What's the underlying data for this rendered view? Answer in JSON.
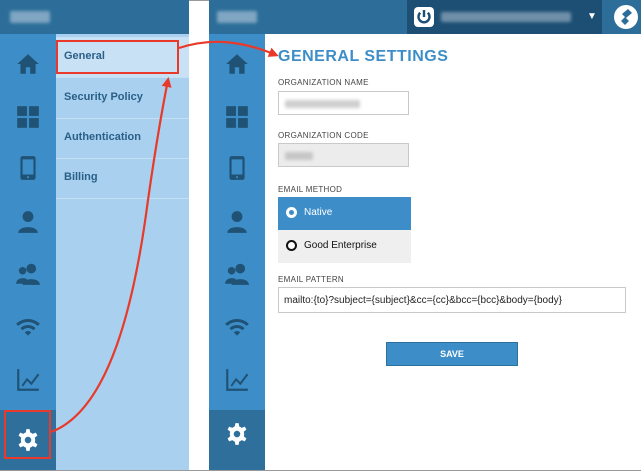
{
  "left_panel": {
    "rail_icons": [
      "home-icon",
      "dashboard-icon",
      "mobile-device-icon",
      "user-icon",
      "users-icon",
      "wifi-icon",
      "analytics-icon",
      "gear-icon"
    ],
    "submenu": [
      {
        "label": "General",
        "active": true
      },
      {
        "label": "Security Policy",
        "active": false
      },
      {
        "label": "Authentication",
        "active": false
      },
      {
        "label": "Billing",
        "active": false
      }
    ]
  },
  "header": {
    "user_caret": "▼",
    "accent_color": "#3d8ec8",
    "topbar_color": "#2c6e99"
  },
  "settings": {
    "title": "GENERAL SETTINGS",
    "org_name_label": "ORGANIZATION NAME",
    "org_code_label": "ORGANIZATION CODE",
    "email_method_label": "EMAIL METHOD",
    "email_methods": [
      {
        "label": "Native",
        "selected": true
      },
      {
        "label": "Good Enterprise",
        "selected": false
      }
    ],
    "email_pattern_label": "EMAIL PATTERN",
    "email_pattern_value": "mailto:{to}?subject={subject}&cc={cc}&bcc={bcc}&body={body}",
    "save_label": "SAVE"
  },
  "annotation_color": "#e8392a"
}
